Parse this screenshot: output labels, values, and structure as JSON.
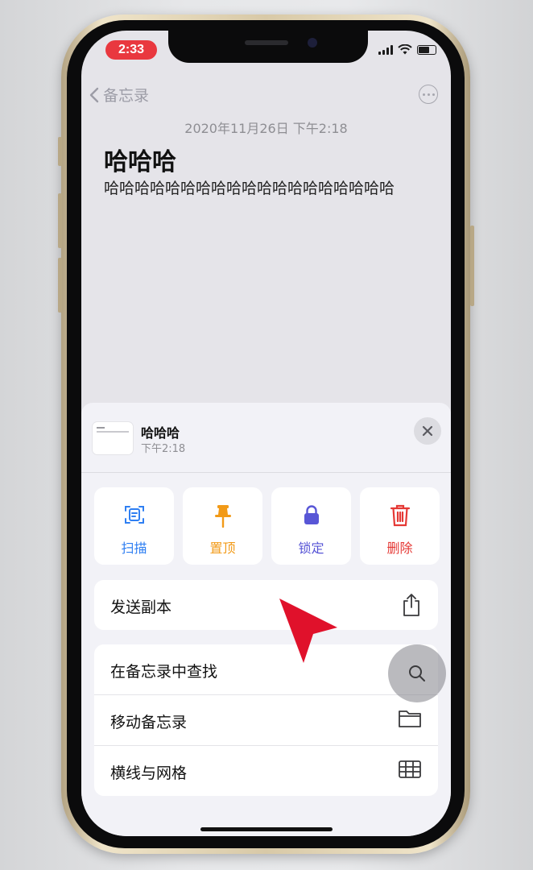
{
  "status": {
    "time": "2:33"
  },
  "nav": {
    "back_label": "备忘录"
  },
  "note": {
    "date": "2020年11月26日 下午2:18",
    "title": "哈哈哈",
    "body": "哈哈哈哈哈哈哈哈哈哈哈哈哈哈哈哈哈哈哈"
  },
  "sheet": {
    "title": "哈哈哈",
    "time": "下午2:18",
    "actions": [
      {
        "label": "扫描",
        "icon": "scan-icon",
        "color": "#2f7ff2"
      },
      {
        "label": "置顶",
        "icon": "pin-icon",
        "color": "#f29a17"
      },
      {
        "label": "锁定",
        "icon": "lock-icon",
        "color": "#5856d6"
      },
      {
        "label": "删除",
        "icon": "trash-icon",
        "color": "#e53935"
      }
    ],
    "send_copy": {
      "label": "发送副本",
      "icon": "share-icon"
    },
    "list": [
      {
        "label": "在备忘录中查找",
        "icon": "search-icon"
      },
      {
        "label": "移动备忘录",
        "icon": "folder-icon"
      },
      {
        "label": "横线与网格",
        "icon": "grid-icon"
      }
    ]
  },
  "colors": {
    "pointer": "#e0112b",
    "time_pill": "#e9383f"
  }
}
